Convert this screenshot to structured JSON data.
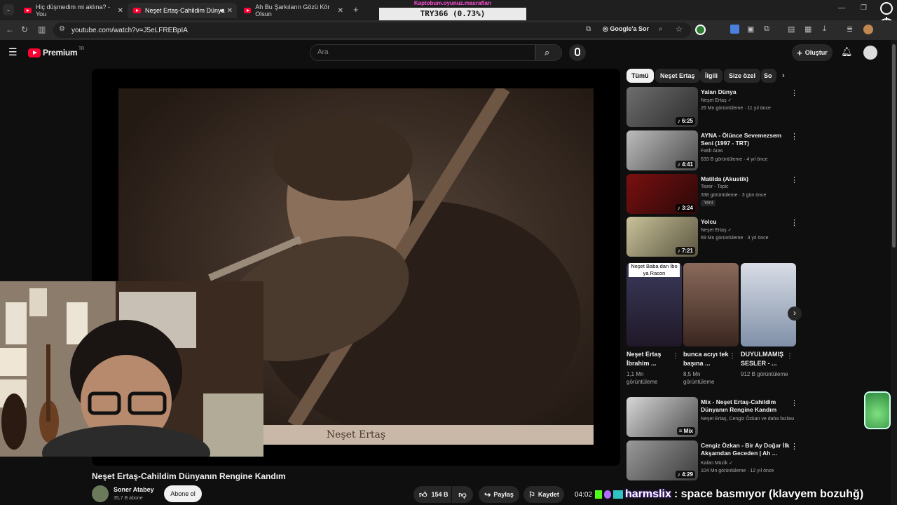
{
  "browser": {
    "tabs": [
      {
        "title": "Hiç düşmedim mi aklına? - You"
      },
      {
        "title": "Neşet Ertaş-Cahildim Dünya"
      },
      {
        "title": "Ah Bu Şarkıların Gözü Kör Olsun"
      }
    ],
    "url": "youtube.com/watch?v=J5eLFREBpIA",
    "ask_google": "Google'a Sor"
  },
  "stream_overlay": {
    "top_text": "Kaptobum.oyunuz.masrafları",
    "pill_text": "TRY366 (0.73%)"
  },
  "youtube": {
    "logo": "Premium",
    "logo_region": "TR",
    "search_placeholder": "Ara",
    "create_label": "Oluştur"
  },
  "video": {
    "caption": "Neşet Ertaş",
    "title": "Neşet Ertaş-Cahildim Dünyanın Rengine Kandım",
    "channel": "Soner Atabey",
    "subscribers": "35,7 B abone",
    "subscribe_label": "Abone ol",
    "likes": "154 B",
    "share_label": "Paylaş",
    "save_label": "Kaydet"
  },
  "chips": [
    "Tümü",
    "Neşet Ertaş",
    "İlgili",
    "Size özel",
    "So"
  ],
  "recommendations": [
    {
      "title": "Yalan Dünya",
      "channel": "Neşet Ertaş",
      "meta": "26 Mn görüntüleme · 11 yıl önce",
      "duration": "6:25",
      "verified": true
    },
    {
      "title": "AYNA - Ölünce Sevemezsem Seni (1997 - TRT)",
      "channel": "Fatih Aras",
      "meta": "633 B görüntüleme · 4 yıl önce",
      "duration": "4:41"
    },
    {
      "title": "Matilda (Akustik)",
      "channel": "Tezer - Topic",
      "meta": "338 görüntüleme · 3 gün önce",
      "duration": "3:24",
      "badge": "Yeni"
    },
    {
      "title": "Yolcu",
      "channel": "Neşet Ertaş",
      "meta": "69 Mn görüntüleme · 3 yıl önce",
      "duration": "7:21",
      "verified": true
    }
  ],
  "shorts": [
    {
      "overlay": "Neşet Baba dan İbo ya Racon",
      "title": "Neşet Ertaş İbrahim ...",
      "views": "1,1 Mn görüntüleme"
    },
    {
      "title": "bunca acıyı tek başına ...",
      "views": "8,5 Mn görüntüleme"
    },
    {
      "title": "DUYULMAMIŞ SESLER - ...",
      "views": "912 B görüntüleme"
    }
  ],
  "recommendations2": [
    {
      "title": "Mix - Neşet Ertaş-Cahildim Dünyanın Rengine Kandım",
      "channel": "Neşet Ertaş, Cengiz Özkan ve daha fazlası",
      "duration": "Mix"
    },
    {
      "title": "Cengiz Özkan - Bir Ay Doğar İlk Akşamdan Geceden | Ah ...",
      "channel": "Kalan Müzik",
      "meta": "104 Mn görüntüleme · 12 yıl önce",
      "duration": "4:29"
    }
  ],
  "chat": {
    "time": "04:02",
    "user": "harmslix",
    "message": ": space basmıyor (klavyem bozuhğ)"
  },
  "colors": {
    "accent_red": "#ff0033",
    "bg": "#0f0f0f",
    "chat_glow": "#7d3cff"
  }
}
